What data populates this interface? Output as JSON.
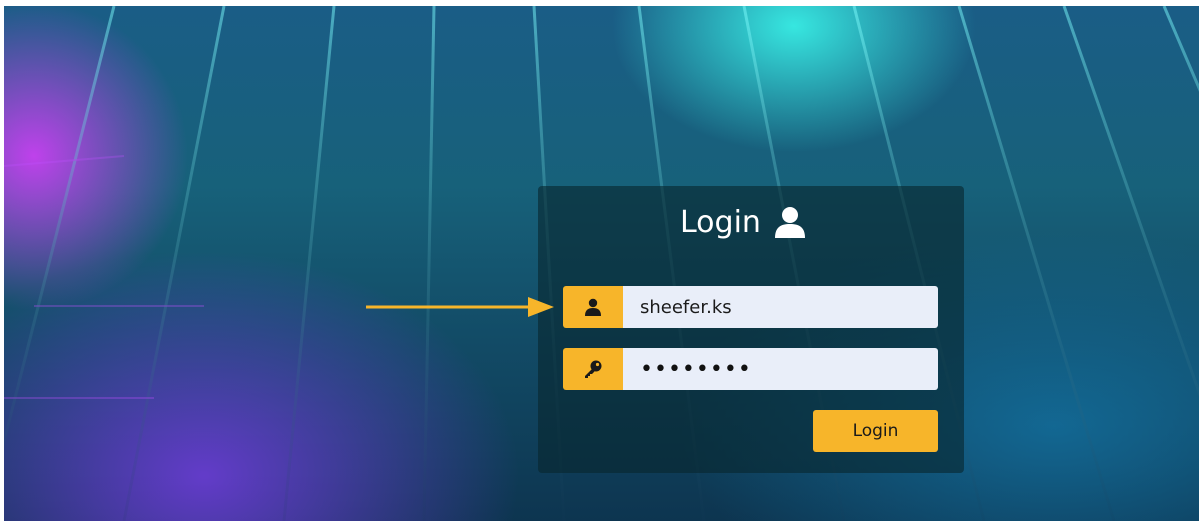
{
  "colors": {
    "accent": "#f7b52a",
    "input_background": "#e9eef9",
    "panel_background": "#08262e",
    "title_text": "#ffffff"
  },
  "login_form": {
    "title": "Login",
    "title_icon": "user-icon",
    "username": {
      "icon": "user-icon",
      "value": "sheefer.ks"
    },
    "password": {
      "icon": "key-icon",
      "masked_value": "••••••••"
    },
    "submit_label": "Login"
  },
  "annotation": {
    "icon": "arrow-right-icon",
    "target": "username-field"
  }
}
